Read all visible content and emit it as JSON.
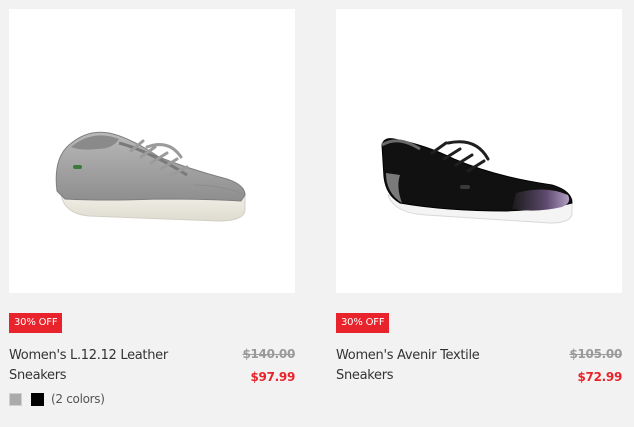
{
  "products": [
    {
      "badge": "30% OFF",
      "name_line1": "Women's L.12.12 Leather",
      "name_line2": "Sneakers",
      "price_old": "$140.00",
      "price_new": "$97.99",
      "swatches": [
        "#aaaaaa",
        "#000000"
      ],
      "colors_count": "(2 colors)",
      "image": "grey-leather-sneaker-image"
    },
    {
      "badge": "30% OFF",
      "name_line1": "Women's Avenir Textile Sneakers",
      "name_line2": "",
      "price_old": "$105.00",
      "price_new": "$72.99",
      "image": "black-textile-sneaker-image"
    }
  ],
  "colors": {
    "sale_red": "#e8232b",
    "page_bg": "#f2f2f2"
  }
}
